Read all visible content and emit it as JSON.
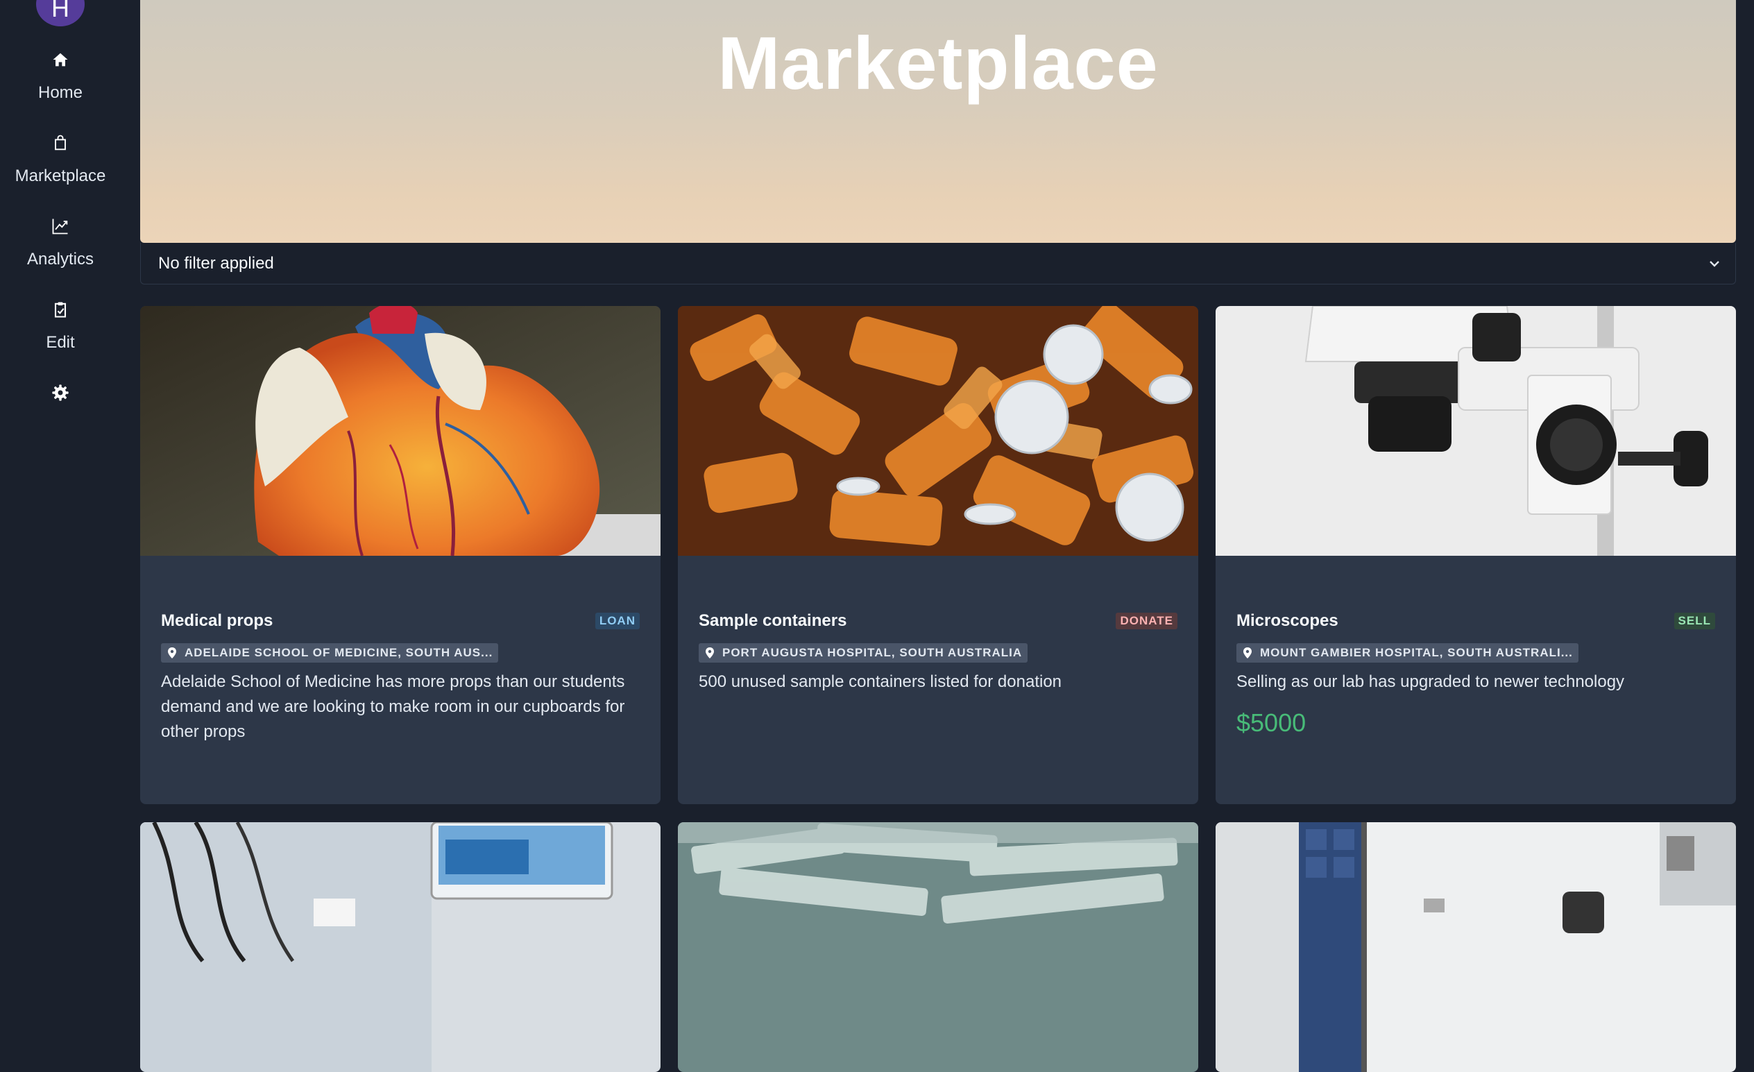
{
  "sidebar": {
    "avatar_initial": "H",
    "items": [
      {
        "label": "Home",
        "icon": "home-icon"
      },
      {
        "label": "Marketplace",
        "icon": "bag-icon"
      },
      {
        "label": "Analytics",
        "icon": "chart-icon"
      },
      {
        "label": "Edit",
        "icon": "clipboard-check-icon"
      },
      {
        "label": "",
        "icon": "gear-icon"
      }
    ]
  },
  "header": {
    "title": "Marketplace"
  },
  "filter": {
    "text": "No filter applied"
  },
  "listings": [
    {
      "title": "Medical props",
      "type": "LOAN",
      "location": "ADELAIDE SCHOOL OF MEDICINE, SOUTH AUS...",
      "description": "Adelaide School of Medicine has more props than our students demand and we are looking to make room in our cupboards for other props",
      "price": ""
    },
    {
      "title": "Sample containers",
      "type": "DONATE",
      "location": "PORT AUGUSTA HOSPITAL, SOUTH AUSTRALIA",
      "description": "500 unused sample containers listed for donation",
      "price": ""
    },
    {
      "title": "Microscopes",
      "type": "SELL",
      "location": "MOUNT GAMBIER HOSPITAL, SOUTH AUSTRALI...",
      "description": "Selling as our lab has upgraded to newer technology",
      "price": "$5000"
    }
  ],
  "colors": {
    "background": "#1a202c",
    "card": "#2d3748",
    "accent": "#553c9a",
    "price": "#48bb78"
  }
}
